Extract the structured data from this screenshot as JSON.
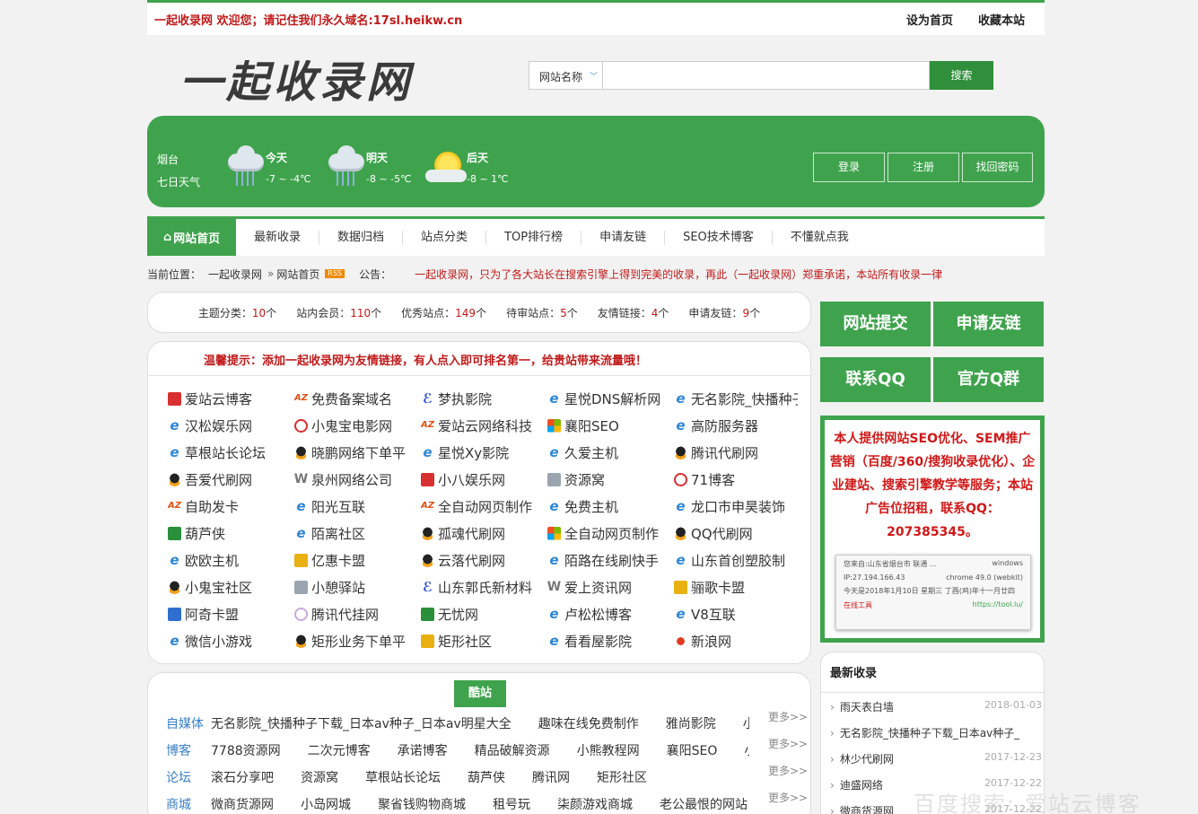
{
  "topbar": {
    "welcome": "一起收录网  欢迎您；请记住我们永久域名:17sl.heikw.cn",
    "set_home": "设为首页",
    "bookmark": "收藏本站"
  },
  "header": {
    "logo": "一起收录网",
    "search_type": "网站名称",
    "search_value": "",
    "search_button": "搜索"
  },
  "weather": {
    "city": "烟台",
    "subtitle": "七日天气",
    "days": [
      {
        "day": "今天",
        "temp": "-7 ~ -4℃",
        "icon": "rain-cloud-icon"
      },
      {
        "day": "明天",
        "temp": "-8 ~ -5℃",
        "icon": "rain-cloud-icon"
      },
      {
        "day": "后天",
        "temp": "-8 ~ 1℃",
        "icon": "sun-cloud-icon"
      }
    ]
  },
  "account": {
    "login": "登录",
    "register": "注册",
    "recover": "找回密码"
  },
  "nav": {
    "home": "网站首页",
    "items": [
      "最新收录",
      "数据归档",
      "站点分类",
      "TOP排行榜",
      "申请友链",
      "SEO技术博客",
      "不懂就点我"
    ]
  },
  "breadcrumb": {
    "label": "当前位置：",
    "site": "一起收录网",
    "page": "网站首页",
    "rss": "RSS",
    "notice_label": "公告：",
    "notice": "一起收录网，只为了各大站长在搜索引擎上得到完美的收录，再此（一起收录网）郑重承诺，本站所有收录一律"
  },
  "stats": [
    {
      "label": "主题分类：",
      "value": "10",
      "unit": "个"
    },
    {
      "label": "站内会员：",
      "value": "110",
      "unit": "个"
    },
    {
      "label": "优秀站点：",
      "value": "149",
      "unit": "个"
    },
    {
      "label": "待审站点：",
      "value": "5",
      "unit": "个"
    },
    {
      "label": "友情链接：",
      "value": "4",
      "unit": "个"
    },
    {
      "label": "申请友链：",
      "value": "9",
      "unit": "个"
    }
  ],
  "links": {
    "tip": "温馨提示：添加一起收录网为友情链接，有人点入即可排名第一，给贵站带来流量哦！",
    "sites": [
      {
        "name": "爱站云博客",
        "icon": "red"
      },
      {
        "name": "免费备案域名",
        "icon": "az"
      },
      {
        "name": "梦执影院",
        "icon": "s"
      },
      {
        "name": "星悦DNS解析网",
        "icon": "ie"
      },
      {
        "name": "无名影院_快播种子",
        "icon": "ie"
      },
      {
        "name": "汉松娱乐网",
        "icon": "ie"
      },
      {
        "name": "小鬼宝电影网",
        "icon": "circle"
      },
      {
        "name": "爱站云网络科技",
        "icon": "az"
      },
      {
        "name": "襄阳SEO",
        "icon": "win"
      },
      {
        "name": "高防服务器",
        "icon": "ie"
      },
      {
        "name": "草根站长论坛",
        "icon": "ie"
      },
      {
        "name": "晓鹏网络下单平",
        "icon": "qq"
      },
      {
        "name": "星悦Xy影院",
        "icon": "ie"
      },
      {
        "name": "久爱主机",
        "icon": "ie"
      },
      {
        "name": "腾讯代刷网",
        "icon": "qq"
      },
      {
        "name": "吾爱代刷网",
        "icon": "qq"
      },
      {
        "name": "泉州网络公司",
        "icon": "w"
      },
      {
        "name": "小八娱乐网",
        "icon": "red"
      },
      {
        "name": "资源窝",
        "icon": "gray"
      },
      {
        "name": "71博客",
        "icon": "circle"
      },
      {
        "name": "自助发卡",
        "icon": "az"
      },
      {
        "name": "阳光互联",
        "icon": "ie"
      },
      {
        "name": "全自动网页制作",
        "icon": "az"
      },
      {
        "name": "免费主机",
        "icon": "ie"
      },
      {
        "name": "龙口市申昊装饰",
        "icon": "ie"
      },
      {
        "name": "葫芦侠",
        "icon": "green"
      },
      {
        "name": "陌离社区",
        "icon": "ie"
      },
      {
        "name": "孤魂代刷网",
        "icon": "qq"
      },
      {
        "name": "全自动网页制作",
        "icon": "win"
      },
      {
        "name": "QQ代刷网",
        "icon": "qq"
      },
      {
        "name": "欧欧主机",
        "icon": "ie"
      },
      {
        "name": "亿惠卡盟",
        "icon": "yellow"
      },
      {
        "name": "云落代刷网",
        "icon": "qq"
      },
      {
        "name": "陌路在线刷快手",
        "icon": "ie"
      },
      {
        "name": "山东首创塑胶制",
        "icon": "ie"
      },
      {
        "name": "小鬼宝社区",
        "icon": "qq"
      },
      {
        "name": "小憩驿站",
        "icon": "gray"
      },
      {
        "name": "山东郭氏新材料",
        "icon": "s"
      },
      {
        "name": "爱上资讯网",
        "icon": "w"
      },
      {
        "name": "骊歌卡盟",
        "icon": "yellow"
      },
      {
        "name": "阿奇卡盟",
        "icon": "blue"
      },
      {
        "name": "腾讯代挂网",
        "icon": "ring"
      },
      {
        "name": "无忧网",
        "icon": "green"
      },
      {
        "name": "卢松松博客",
        "icon": "ie"
      },
      {
        "name": "V8互联",
        "icon": "ie"
      },
      {
        "name": "微信小游戏",
        "icon": "ie"
      },
      {
        "name": "矩形业务下单平",
        "icon": "qq"
      },
      {
        "name": "矩形社区",
        "icon": "yellow"
      },
      {
        "name": "看看屋影院",
        "icon": "ie"
      },
      {
        "name": "新浪网",
        "icon": "weibo"
      }
    ]
  },
  "cool": {
    "title": "酷站",
    "more": "更多>>",
    "rows": [
      {
        "cat": "自媒体",
        "items": [
          "无名影院_快播种子下载_日本av种子_日本av明星大全",
          "趣味在线免费制作",
          "雅尚影院",
          "小"
        ]
      },
      {
        "cat": "博客",
        "items": [
          "7788资源网",
          "二次元博客",
          "承诺博客",
          "精品破解资源",
          "小熊教程网",
          "襄阳SEO",
          "小"
        ]
      },
      {
        "cat": "论坛",
        "items": [
          "滚石分享吧",
          "资源窝",
          "草根站长论坛",
          "葫芦侠",
          "腾讯网",
          "矩形社区"
        ]
      },
      {
        "cat": "商城",
        "items": [
          "微商货源网",
          "小岛网城",
          "聚省钱购物商城",
          "租号玩",
          "柒颜游戏商城",
          "老公最恨的网站"
        ]
      }
    ]
  },
  "right": {
    "buttons": [
      "网站提交",
      "申请友链",
      "联系QQ",
      "官方Q群"
    ],
    "ad_text": "本人提供网站SEO优化、SEM推广营销（百度/360/搜狗收录优化）、企业建站、搜索引擎教学等服务；本站广告位招租，联系QQ：207385345。",
    "ipcard": {
      "line1_left": "您来自:山东省烟台市 联通 ...",
      "line1_right": "windows",
      "line2_left": "IP:27.194.166.43",
      "line2_right": "chrome 49.0 (webkit)",
      "line3": "今天是2018年1月10日 星期三 丁酉(鸡)年十一月廿四",
      "line4_left": "在线工具",
      "line4_right": "https://tool.lu/"
    },
    "latest_title": "最新收录",
    "latest": [
      {
        "name": "雨天表白墙",
        "date": "2018-01-03"
      },
      {
        "name": "无名影院_快播种子下载_日本av种子_",
        "date": ""
      },
      {
        "name": "林少代刷网",
        "date": "2017-12-23"
      },
      {
        "name": "迪盛网络",
        "date": "2017-12-22"
      },
      {
        "name": "微商货源网",
        "date": "2017-12-22"
      }
    ]
  },
  "watermark": "百度搜索: 爱站云博客"
}
